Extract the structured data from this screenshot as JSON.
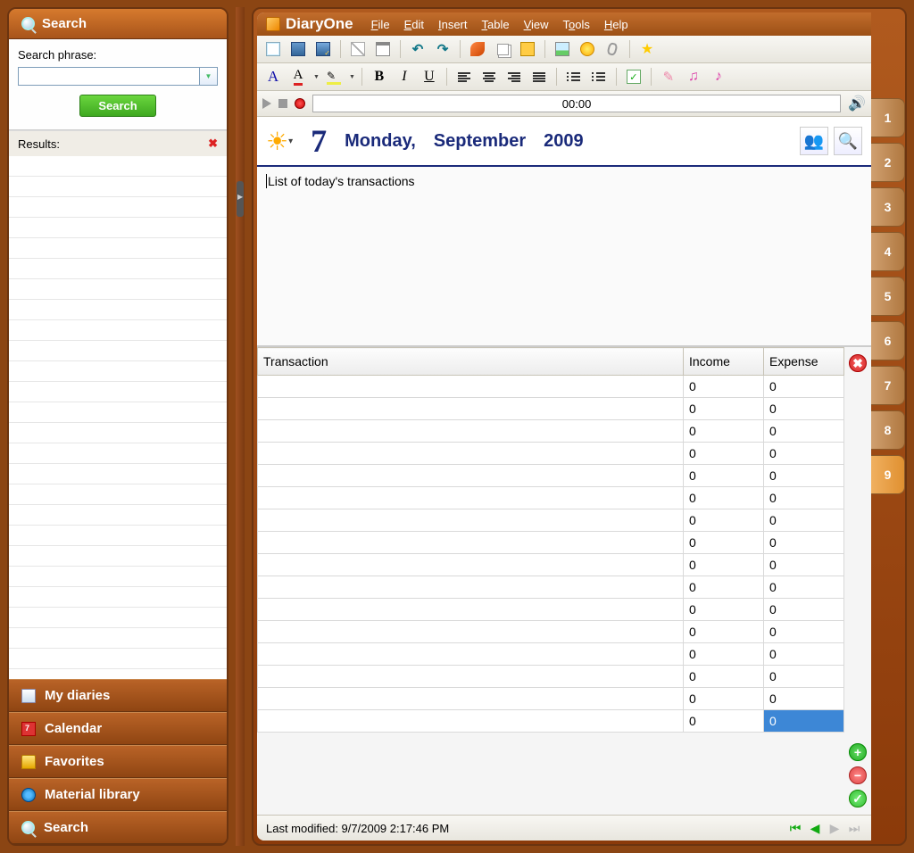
{
  "sidebar": {
    "search_header": "Search",
    "search_label": "Search phrase:",
    "search_button": "Search",
    "results_label": "Results:",
    "nav": [
      {
        "label": "My diaries"
      },
      {
        "label": "Calendar"
      },
      {
        "label": "Favorites"
      },
      {
        "label": "Material library"
      },
      {
        "label": "Search"
      }
    ]
  },
  "app": {
    "title": "DiaryOne",
    "menus": [
      "File",
      "Edit",
      "Insert",
      "Table",
      "View",
      "Tools",
      "Help"
    ]
  },
  "audio": {
    "time": "00:00"
  },
  "date": {
    "daynum": "7",
    "weekday": "Monday,",
    "month": "September",
    "year": "2009"
  },
  "editor": {
    "text": "List of today's transactions"
  },
  "table": {
    "headers": [
      "Transaction",
      "Income",
      "Expense"
    ],
    "rows": [
      {
        "t": "",
        "i": "0",
        "e": "0"
      },
      {
        "t": "",
        "i": "0",
        "e": "0"
      },
      {
        "t": "",
        "i": "0",
        "e": "0"
      },
      {
        "t": "",
        "i": "0",
        "e": "0"
      },
      {
        "t": "",
        "i": "0",
        "e": "0"
      },
      {
        "t": "",
        "i": "0",
        "e": "0"
      },
      {
        "t": "",
        "i": "0",
        "e": "0"
      },
      {
        "t": "",
        "i": "0",
        "e": "0"
      },
      {
        "t": "",
        "i": "0",
        "e": "0"
      },
      {
        "t": "",
        "i": "0",
        "e": "0"
      },
      {
        "t": "",
        "i": "0",
        "e": "0"
      },
      {
        "t": "",
        "i": "0",
        "e": "0"
      },
      {
        "t": "",
        "i": "0",
        "e": "0"
      },
      {
        "t": "",
        "i": "0",
        "e": "0"
      },
      {
        "t": "",
        "i": "0",
        "e": "0"
      },
      {
        "t": "",
        "i": "0",
        "e": "0",
        "sel": true
      }
    ]
  },
  "status": {
    "text": "Last modified: 9/7/2009 2:17:46 PM"
  },
  "tabs": [
    "1",
    "2",
    "3",
    "4",
    "5",
    "6",
    "7",
    "8",
    "9"
  ],
  "active_tab": "9"
}
